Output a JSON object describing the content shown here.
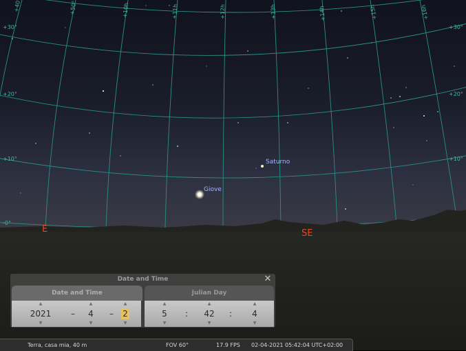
{
  "sky": {
    "grid_labels_top": [
      "+40°",
      "+50°",
      "+10h",
      "+11h",
      "+12h",
      "+13h",
      "+14h",
      "+15h",
      "+16h"
    ],
    "alt_labels_left": [
      "+30°",
      "+20°",
      "+10°",
      "-0°"
    ],
    "alt_labels_right": [
      "+30°",
      "+20°",
      "+10°"
    ],
    "planets": [
      {
        "name": "Saturno"
      },
      {
        "name": "Giove"
      }
    ],
    "cardinals": {
      "east": "E",
      "southeast": "SE"
    },
    "colors": {
      "grid": "#3fb8a8",
      "planet_label": "#a9b6ff",
      "cardinal": "#e8472e"
    }
  },
  "dialog": {
    "title": "Date and Time",
    "close_icon": "✕",
    "tabs": {
      "date_time": "Date and Time",
      "julian_day": "Julian Day"
    },
    "date": {
      "year": "2021",
      "month": "4",
      "day": "2",
      "separator": "–"
    },
    "time": {
      "hour": "5",
      "minute": "42",
      "second": "4",
      "separator": ":"
    },
    "arrow_up": "▲",
    "arrow_down": "▼"
  },
  "statusbar": {
    "location": "Terra, casa mia, 40 m",
    "fov": "FOV 60°",
    "fps": "17.9 FPS",
    "datetime": "02-04-2021 05:42:04 UTC+02:00"
  }
}
